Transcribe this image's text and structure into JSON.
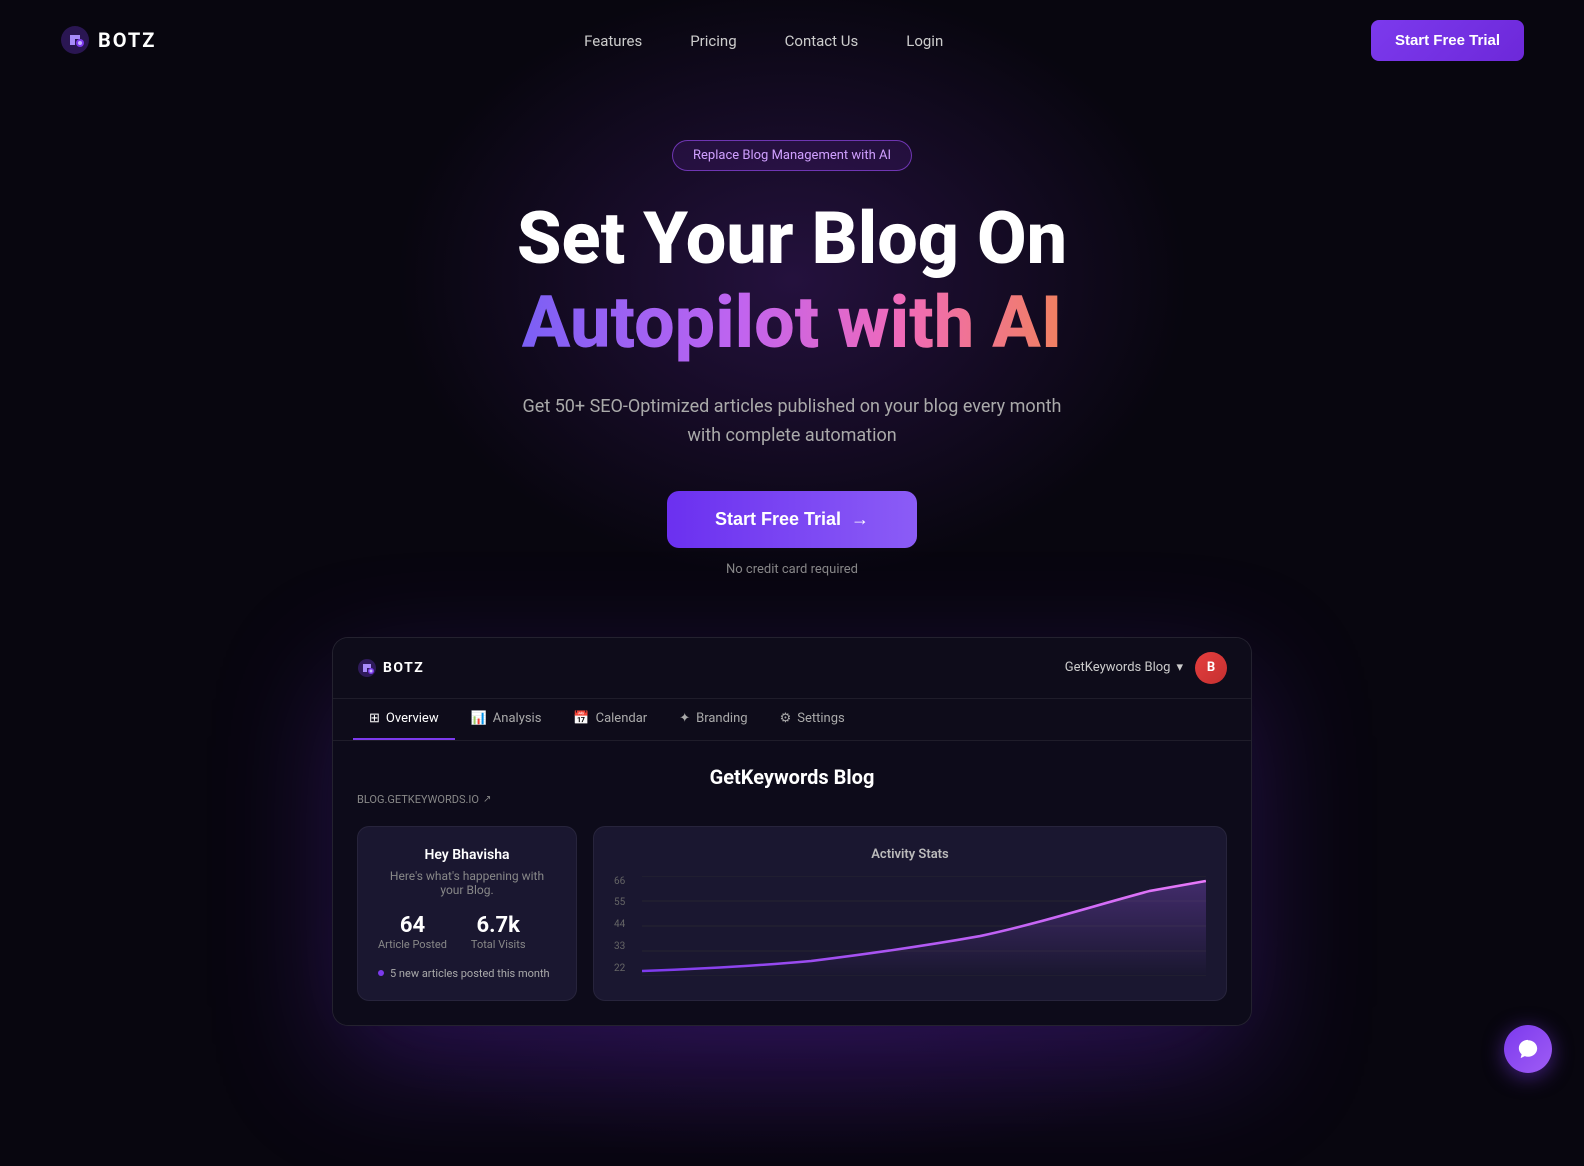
{
  "brand": {
    "name": "BOTZ"
  },
  "nav": {
    "links": [
      {
        "label": "Features",
        "id": "features"
      },
      {
        "label": "Pricing",
        "id": "pricing"
      },
      {
        "label": "Contact Us",
        "id": "contact"
      },
      {
        "label": "Login",
        "id": "login"
      }
    ],
    "cta_label": "Start Free Trial"
  },
  "hero": {
    "badge": "Replace Blog Management with AI",
    "title_white": "Set Your Blog On",
    "title_gradient": "Autopilot with AI",
    "subtitle": "Get 50+ SEO-Optimized articles published on your blog every month with complete automation",
    "cta_label": "Start Free Trial",
    "cta_arrow": "→",
    "no_cc": "No credit card required"
  },
  "app_preview": {
    "brand": "BOTZ",
    "blog_selector": "GetKeywords Blog",
    "avatar_letter": "B",
    "tabs": [
      {
        "label": "Overview",
        "icon": "grid",
        "active": true
      },
      {
        "label": "Analysis",
        "icon": "bar-chart",
        "active": false
      },
      {
        "label": "Calendar",
        "icon": "calendar",
        "active": false
      },
      {
        "label": "Branding",
        "icon": "star",
        "active": false
      },
      {
        "label": "Settings",
        "icon": "gear",
        "active": false
      }
    ],
    "blog_title": "GetKeywords Blog",
    "blog_url": "BLOG.GETKEYWORDS.IO",
    "welcome_card": {
      "greeting": "Hey Bhavisha",
      "subtext": "Here's what's happening with your Blog.",
      "stats": [
        {
          "value": "64",
          "label": "Article Posted"
        },
        {
          "value": "6.7k",
          "label": "Total Visits"
        }
      ],
      "notice": "5 new articles posted this month"
    },
    "activity_card": {
      "title": "Activity Stats",
      "y_labels": [
        "66",
        "55",
        "44",
        "33",
        "22"
      ],
      "chart_data": [
        5,
        8,
        12,
        15,
        20,
        28,
        38,
        52,
        72,
        88
      ]
    }
  },
  "chat": {
    "icon": "chat-bubble-icon"
  }
}
